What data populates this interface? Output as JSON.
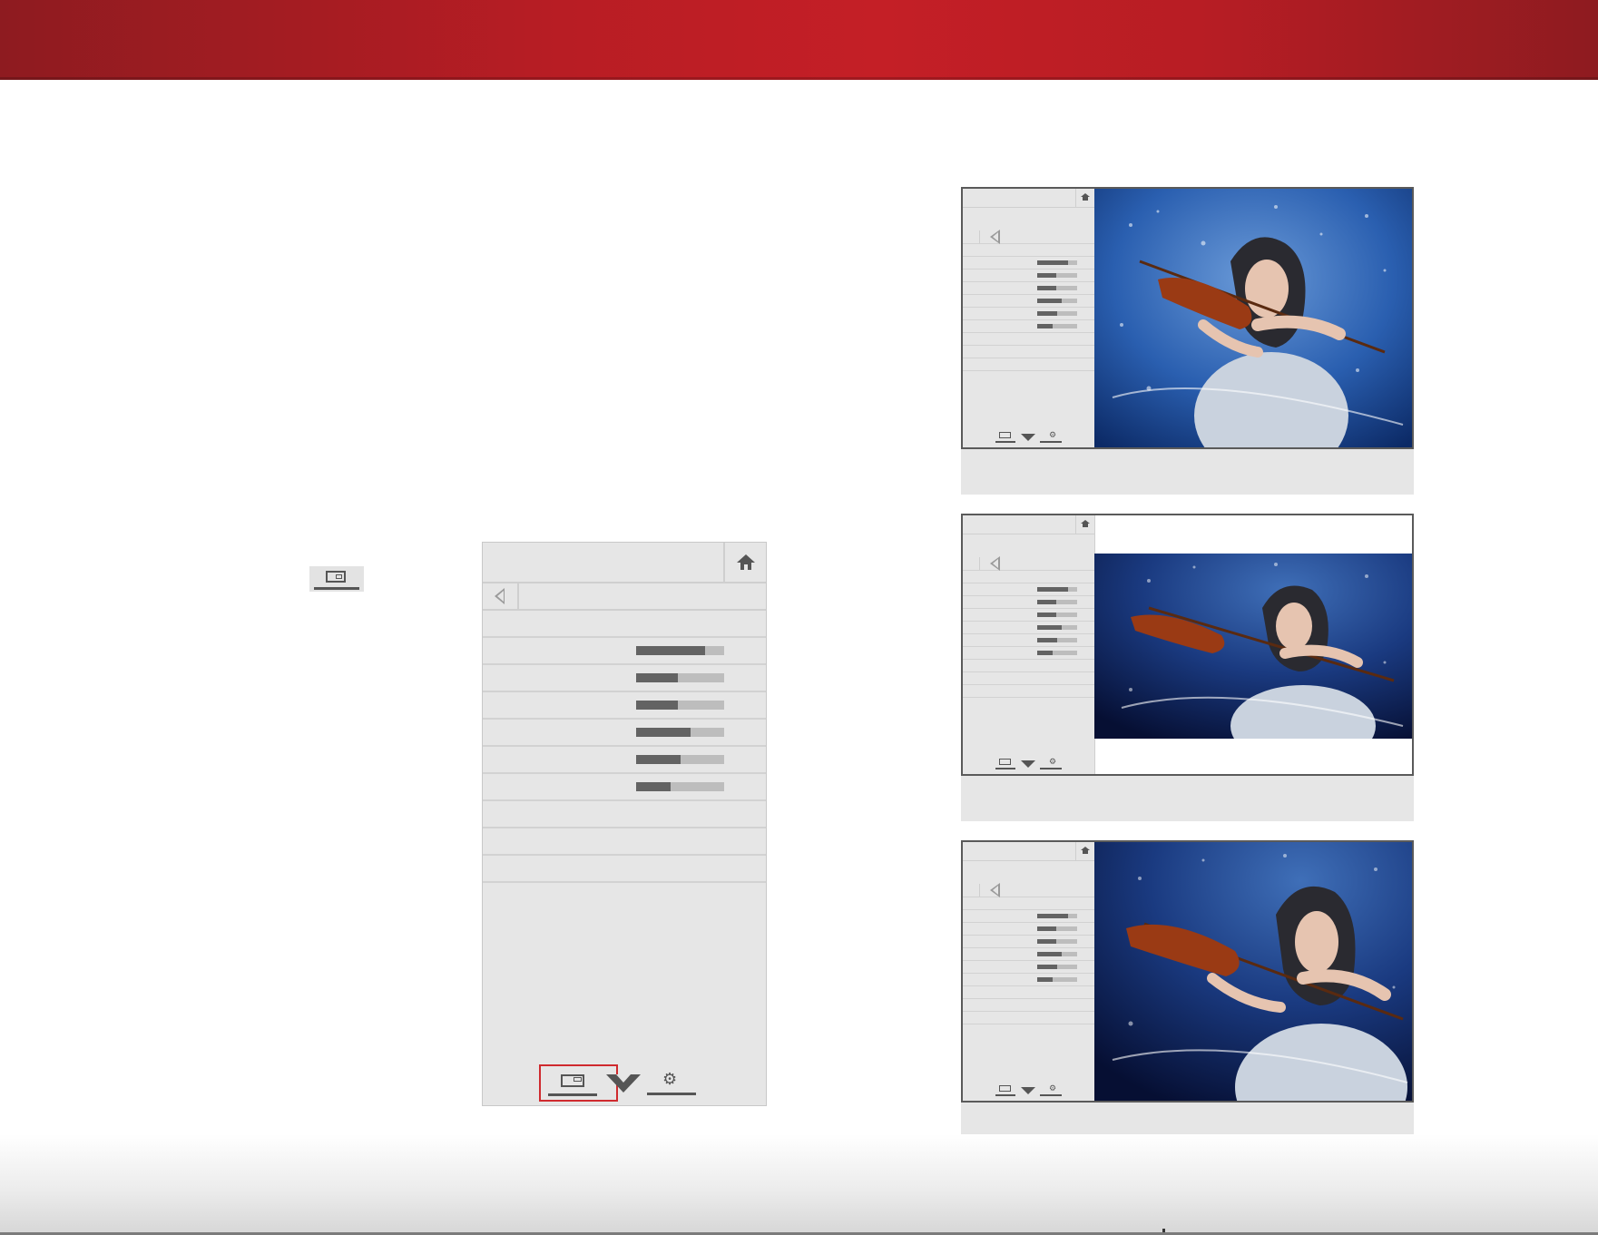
{
  "colors": {
    "header_red": "#c41f26",
    "selection_outline": "#cf2a2e",
    "menu_gray": "#e6e6e6",
    "slider_fill": "#636363",
    "slider_track": "#bdbdbd"
  },
  "icons": {
    "input": "input-screen-icon",
    "home": "home-icon",
    "back": "back-arrow-icon",
    "brand": "v-chevron-icon",
    "settings": "gear-icon"
  },
  "main_menu": {
    "slider_levels": [
      0.78,
      0.47,
      0.47,
      0.62,
      0.5,
      0.39
    ],
    "selected_footer_item": "input"
  },
  "thumbnails": [
    {
      "variant": "full-image",
      "slider_levels": [
        0.78,
        0.47,
        0.47,
        0.62,
        0.5,
        0.39
      ]
    },
    {
      "variant": "letterboxed",
      "slider_levels": [
        0.78,
        0.47,
        0.47,
        0.62,
        0.5,
        0.39
      ]
    },
    {
      "variant": "stretched",
      "slider_levels": [
        0.78,
        0.47,
        0.47,
        0.62,
        0.5,
        0.39
      ]
    }
  ]
}
